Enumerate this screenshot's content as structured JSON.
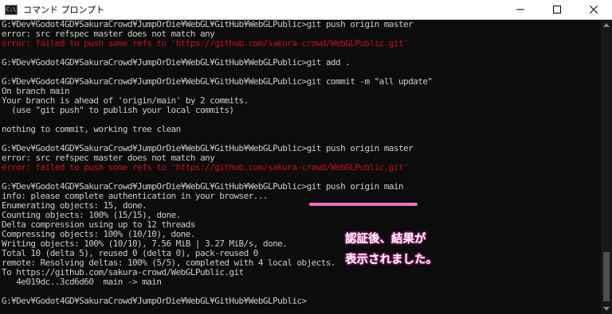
{
  "window": {
    "title": "コマンド プロンプト",
    "app_icon_text": "C:\\"
  },
  "colors": {
    "background": "#0c0c0c",
    "text": "#cccccc",
    "error_text": "#c50f1f",
    "highlight": "#f06ec0"
  },
  "console": {
    "lines": [
      {
        "text": "G:¥Dev¥Godot4GD¥SakuraCrowd¥JumpOrDie¥WebGL¥GitHub¥WebGLPublic>git push origin master",
        "kind": "normal"
      },
      {
        "text": "error: src refspec master does not match any",
        "kind": "normal"
      },
      {
        "text": "error: failed to push some refs to 'https://github.com/sakura-crowd/WebGLPublic.git'",
        "kind": "err"
      },
      {
        "text": "",
        "kind": "blank"
      },
      {
        "text": "G:¥Dev¥Godot4GD¥SakuraCrowd¥JumpOrDie¥WebGL¥GitHub¥WebGLPublic>git add .",
        "kind": "normal"
      },
      {
        "text": "",
        "kind": "blank"
      },
      {
        "text": "G:¥Dev¥Godot4GD¥SakuraCrowd¥JumpOrDie¥WebGL¥GitHub¥WebGLPublic>git commit -m \"all update\"",
        "kind": "normal"
      },
      {
        "text": "On branch main",
        "kind": "normal"
      },
      {
        "text": "Your branch is ahead of 'origin/main' by 2 commits.",
        "kind": "normal"
      },
      {
        "text": "  (use \"git push\" to publish your local commits)",
        "kind": "normal"
      },
      {
        "text": "",
        "kind": "blank"
      },
      {
        "text": "nothing to commit, working tree clean",
        "kind": "normal"
      },
      {
        "text": "",
        "kind": "blank"
      },
      {
        "text": "G:¥Dev¥Godot4GD¥SakuraCrowd¥JumpOrDie¥WebGL¥GitHub¥WebGLPublic>git push origin master",
        "kind": "normal"
      },
      {
        "text": "error: src refspec master does not match any",
        "kind": "normal"
      },
      {
        "text": "error: failed to push some refs to 'https://github.com/sakura-crowd/WebGLPublic.git'",
        "kind": "err"
      },
      {
        "text": "",
        "kind": "blank"
      },
      {
        "text": "G:¥Dev¥Godot4GD¥SakuraCrowd¥JumpOrDie¥WebGL¥GitHub¥WebGLPublic>git push origin main",
        "kind": "normal"
      },
      {
        "text": "info: please complete authentication in your browser...",
        "kind": "normal"
      },
      {
        "text": "Enumerating objects: 15, done.",
        "kind": "normal"
      },
      {
        "text": "Counting objects: 100% (15/15), done.",
        "kind": "normal"
      },
      {
        "text": "Delta compression using up to 12 threads",
        "kind": "normal"
      },
      {
        "text": "Compressing objects: 100% (10/10), done.",
        "kind": "normal"
      },
      {
        "text": "Writing objects: 100% (10/10), 7.56 MiB | 3.27 MiB/s, done.",
        "kind": "normal"
      },
      {
        "text": "Total 10 (delta 5), reused 0 (delta 0), pack-reused 0",
        "kind": "normal"
      },
      {
        "text": "remote: Resolving deltas: 100% (5/5), completed with 4 local objects.",
        "kind": "normal"
      },
      {
        "text": "To https://github.com/sakura-crowd/WebGLPublic.git",
        "kind": "normal"
      },
      {
        "text": "   4e019dc..3cd6d60  main -> main",
        "kind": "normal"
      },
      {
        "text": "",
        "kind": "blank"
      },
      {
        "text": "G:¥Dev¥Godot4GD¥SakuraCrowd¥JumpOrDie¥WebGL¥GitHub¥WebGLPublic>",
        "kind": "normal"
      }
    ]
  },
  "annotation": {
    "text": "認証後、結果が\n表示されました。"
  }
}
